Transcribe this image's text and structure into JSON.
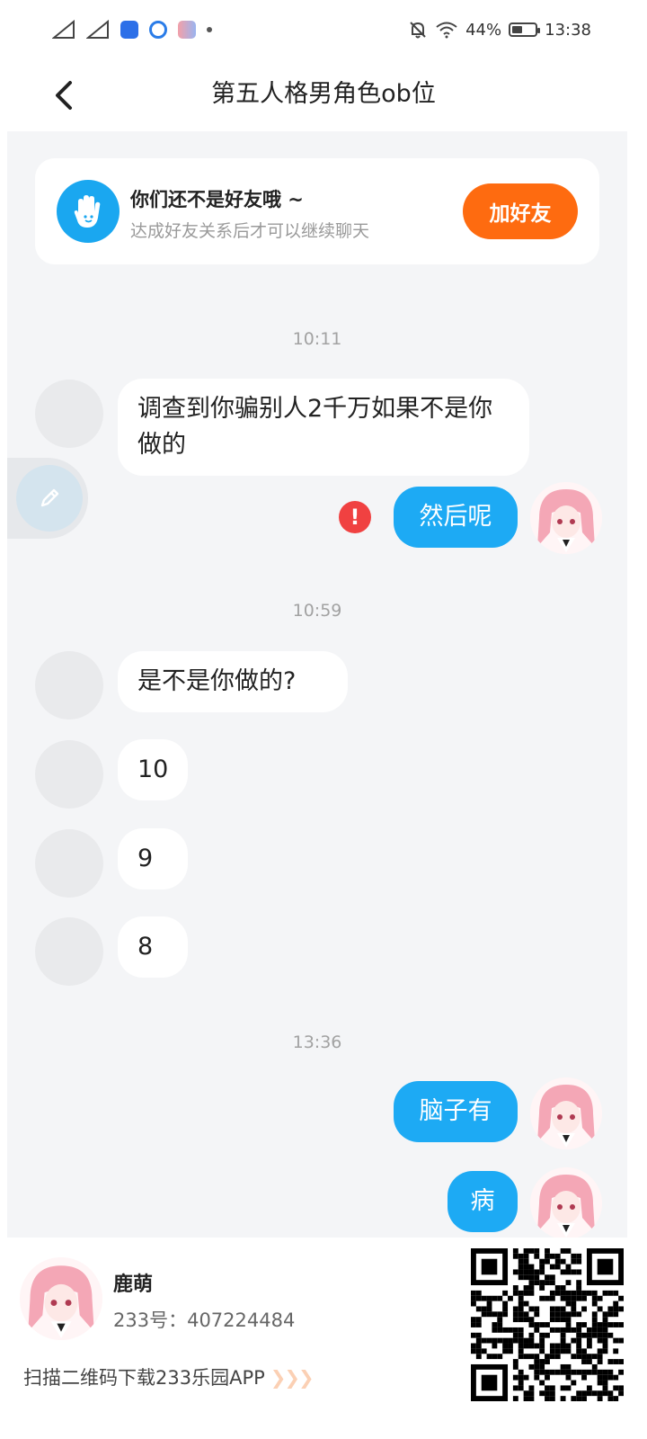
{
  "status_bar": {
    "battery_percent": "44%",
    "battery_level": 0.44,
    "time": "13:38"
  },
  "header": {
    "title": "第五人格男角色ob位"
  },
  "friend_card": {
    "title": "你们还不是好友哦 ~",
    "subtitle": "达成好友关系后才可以继续聊天",
    "button_label": "加好友"
  },
  "messages": {
    "t1": "10:11",
    "m1": "调查到你骗别人2千万如果不是你做的",
    "m2": "然后呢",
    "m2_error_mark": "!",
    "t2": "10:59",
    "m3": "是不是你做的?",
    "m4": "10",
    "m5": "9",
    "m6": "8",
    "t3": "13:36",
    "m7": "脑子有",
    "m8": "病"
  },
  "footer": {
    "name": "鹿萌",
    "id_line": "233号：407224484",
    "scan_text": "扫描二维码下载233乐园APP",
    "arrows": "❯❯❯"
  },
  "colors": {
    "accent_blue": "#1daaf4",
    "add_friend_orange": "#fe6b10",
    "error_red": "#f04141",
    "chat_background": "#f4f5f7"
  }
}
